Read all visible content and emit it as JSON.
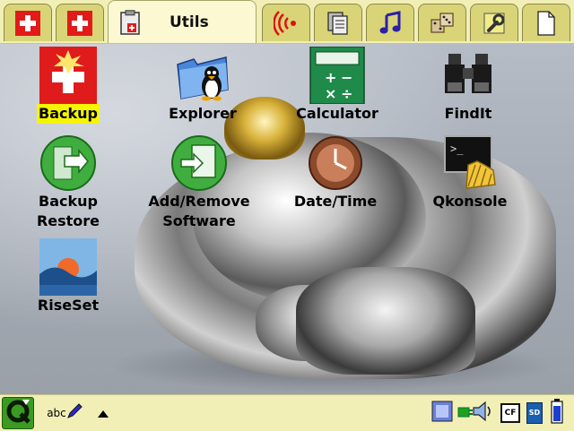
{
  "tabbar": {
    "tabs": [
      {
        "id": "tab-1",
        "icon": "swiss-cross-icon"
      },
      {
        "id": "tab-2",
        "icon": "swiss-cross-icon"
      },
      {
        "id": "tab-utils",
        "icon": "clipboard-icon",
        "label": "Utils",
        "active": true
      },
      {
        "id": "tab-4",
        "icon": "wireless-icon"
      },
      {
        "id": "tab-5",
        "icon": "documents-icon"
      },
      {
        "id": "tab-6",
        "icon": "music-note-icon"
      },
      {
        "id": "tab-7",
        "icon": "dice-icon"
      },
      {
        "id": "tab-8",
        "icon": "wrench-icon"
      },
      {
        "id": "tab-9",
        "icon": "document-icon"
      }
    ]
  },
  "apps": [
    {
      "label": "Backup",
      "icon": "backup-swiss-icon",
      "selected": true
    },
    {
      "label": "Explorer",
      "icon": "penguin-folder-icon"
    },
    {
      "label": "Calculator",
      "icon": "calculator-icon"
    },
    {
      "label": "FindIt",
      "icon": "binoculars-icon"
    },
    {
      "label": "Backup\nRestore",
      "line1": "Backup",
      "line2": "Restore",
      "icon": "restore-arrow-icon"
    },
    {
      "label": "Add/Remove Software",
      "line1": "Add/Remove",
      "line2": "Software",
      "icon": "package-icon"
    },
    {
      "label": "Date/Time",
      "icon": "clock-icon"
    },
    {
      "label": "Qkonsole",
      "icon": "terminal-shell-icon"
    },
    {
      "label": "RiseSet",
      "icon": "sunset-icon"
    }
  ],
  "taskbar": {
    "start_icon": "q-logo-icon",
    "input_method_label": "abc",
    "input_icon": "pencil-icon",
    "up_arrow_icon": "triangle-up-icon",
    "tray": [
      "network-icon",
      "plug-icon",
      "speaker-icon",
      "cf-card-icon",
      "sd-card-icon",
      "battery-icon"
    ],
    "cf_label": "CF",
    "sd_label": "SD"
  },
  "colors": {
    "bar_bg": "#f2efb6",
    "tab_bg": "#d9d477",
    "active_tab_bg": "#fbf8d2",
    "selection_highlight": "#f5f500"
  }
}
